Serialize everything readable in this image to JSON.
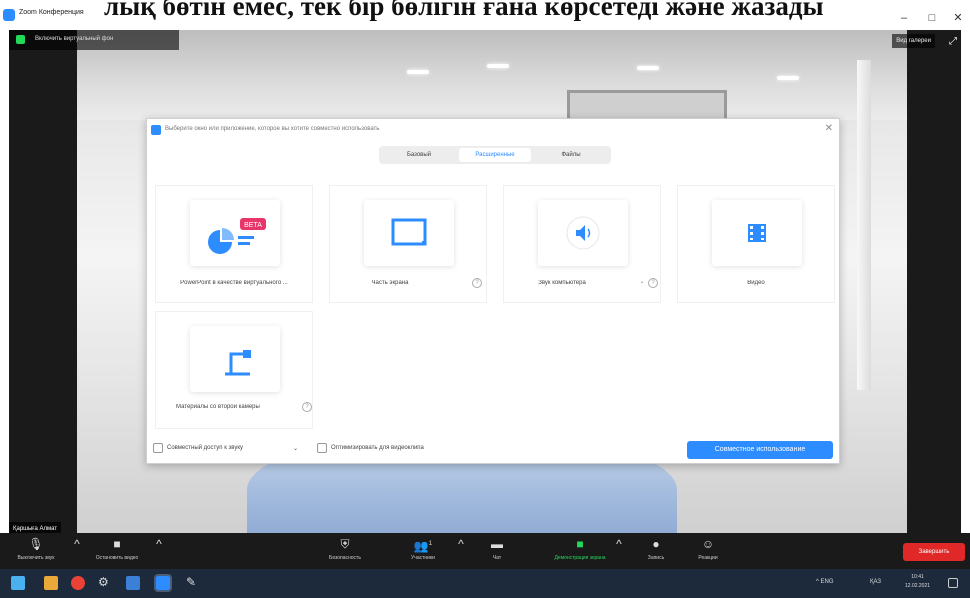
{
  "window": {
    "app_title": "Zoom Конференция",
    "overlay_text": "лық бөтін емес, тек бір бөлігін ғана көрсетеді және жазады"
  },
  "camera_bar": {
    "label": "Включить виртуальный фон",
    "view_button": "Вид галереи"
  },
  "participant_name": "Қаршыға Алмат",
  "share_dialog": {
    "title": "Выберите окно или приложение, которое вы хотите совместно использовать",
    "tabs": [
      {
        "label": "Базовый",
        "active": false
      },
      {
        "label": "Расширенные",
        "active": true
      },
      {
        "label": "Файлы",
        "active": false
      }
    ],
    "options": [
      {
        "caption": "PowerPoint в качестве виртуального ...",
        "badge": "BETA",
        "icon": "powerpoint-virtual-background-icon"
      },
      {
        "caption": "Часть экрана",
        "icon": "portion-of-screen-icon"
      },
      {
        "caption": "Звук компьютера",
        "icon": "computer-audio-icon"
      },
      {
        "caption": "Видео",
        "icon": "video-file-icon"
      },
      {
        "caption": "Материалы со второй камеры",
        "icon": "second-camera-icon"
      }
    ],
    "footer": {
      "share_sound_label": "Совместный доступ к звуку",
      "optimize_label": "Оптимизировать для видеоклипа",
      "share_button": "Совместное использование"
    }
  },
  "controls": {
    "mute": "Выключить звук",
    "stop_video": "Остановить видео",
    "security": "Безопасность",
    "participants": "Участники",
    "participants_count": "1",
    "chat": "Чат",
    "share_screen": "Демонстрация экрана",
    "record": "Запись",
    "reactions": "Реакции",
    "end": "Завершить"
  },
  "taskbar": {
    "tray_text": "^ ENG",
    "language": "ҚАЗ",
    "time": "10:41",
    "date": "12.02.2021"
  },
  "colors": {
    "accent": "#2d8cff",
    "end_red": "#e02828",
    "active_green": "#23d959",
    "beta_badge": "#e8356a"
  }
}
